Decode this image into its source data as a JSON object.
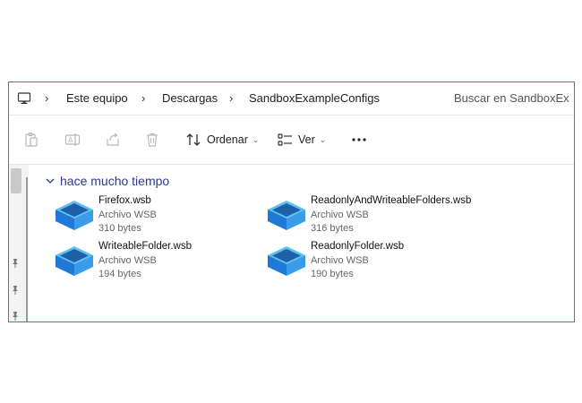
{
  "breadcrumb": {
    "root_icon": "computer-icon",
    "items": [
      "Este equipo",
      "Descargas",
      "SandboxExampleConfigs"
    ]
  },
  "search": {
    "placeholder": "Buscar en SandboxEx"
  },
  "toolbar": {
    "icons": [
      "paste-icon",
      "rename-icon",
      "share-icon",
      "delete-icon"
    ],
    "sort_label": "Ordenar",
    "view_label": "Ver",
    "more_icon": "ellipsis-icon"
  },
  "group": {
    "label": "hace mucho tiempo"
  },
  "files": [
    {
      "name": "Firefox.wsb",
      "type": "Archivo WSB",
      "size": "310 bytes"
    },
    {
      "name": "ReadonlyAndWriteableFolders.wsb",
      "type": "Archivo WSB",
      "size": "316 bytes"
    },
    {
      "name": "WriteableFolder.wsb",
      "type": "Archivo WSB",
      "size": "194 bytes"
    },
    {
      "name": "ReadonlyFolder.wsb",
      "type": "Archivo WSB",
      "size": "190 bytes"
    }
  ],
  "colors": {
    "accent_border": "#2e8f88",
    "group_header": "#2d3a8a",
    "file_icon_blue": "#1e7ad6"
  }
}
